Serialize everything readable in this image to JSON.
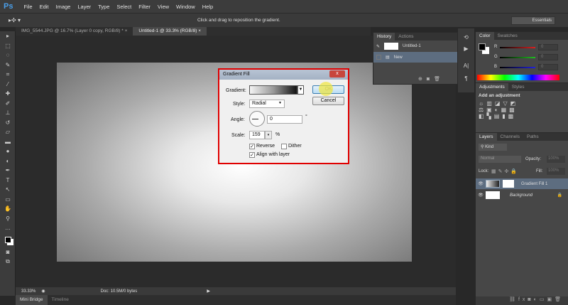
{
  "app": {
    "logo": "Ps",
    "menus": [
      "File",
      "Edit",
      "Image",
      "Layer",
      "Type",
      "Select",
      "Filter",
      "View",
      "Window",
      "Help"
    ]
  },
  "options": {
    "hint": "Click and drag to reposition the gradient.",
    "workspace": "Essentials"
  },
  "tabs": [
    {
      "label": "IMG_5544.JPG @ 16.7% (Layer 0 copy, RGB/8) *",
      "close": "×"
    },
    {
      "label": "Untitled-1 @ 33.3% (RGB/8)",
      "close": "×"
    }
  ],
  "status": {
    "zoom": "33.33%",
    "doc": "Doc: 10.5M/0 bytes"
  },
  "bottom_tabs": [
    "Mini Bridge",
    "Timeline"
  ],
  "dialog": {
    "title": "Gradient Fill",
    "close": "x",
    "gradient_label": "Gradient:",
    "style_label": "Style:",
    "style_value": "Radial",
    "angle_label": "Angle:",
    "angle_value": "0",
    "angle_unit": "°",
    "scale_label": "Scale:",
    "scale_value": "159",
    "scale_unit": "%",
    "reverse": "Reverse",
    "reverse_checked": true,
    "dither": "Dither",
    "dither_checked": false,
    "align": "Align with layer",
    "align_checked": true,
    "ok": "OK",
    "cancel": "Cancel"
  },
  "history": {
    "tabs": [
      "History",
      "Actions"
    ],
    "items": [
      "Untitled-1",
      "New"
    ]
  },
  "color": {
    "tabs": [
      "Color",
      "Swatches"
    ],
    "channels": [
      {
        "label": "R",
        "value": "0",
        "color": "#e02020"
      },
      {
        "label": "G",
        "value": "0",
        "color": "#20c020"
      },
      {
        "label": "B",
        "value": "0",
        "color": "#2020e0"
      }
    ]
  },
  "adjustments": {
    "tabs": [
      "Adjustments",
      "Styles"
    ],
    "heading": "Add an adjustment"
  },
  "layers": {
    "tabs": [
      "Layers",
      "Channels",
      "Paths"
    ],
    "filter": "Kind",
    "blend": "Normal",
    "opacity_label": "Opacity:",
    "opacity": "100%",
    "lock_label": "Lock:",
    "fill_label": "Fill:",
    "fill": "100%",
    "items": [
      {
        "name": "Gradient Fill 1",
        "selected": true
      },
      {
        "name": "Background",
        "selected": false
      }
    ]
  }
}
